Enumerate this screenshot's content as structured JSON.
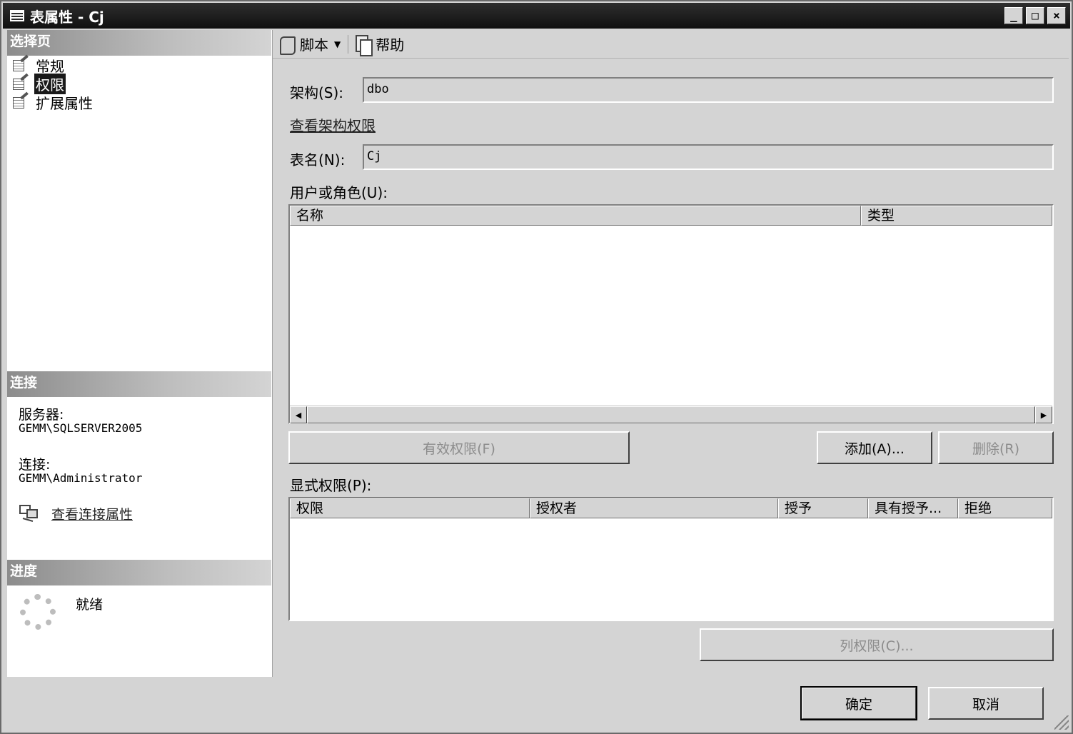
{
  "window": {
    "title": "表属性 - Cj",
    "controls": {
      "minimize": "_",
      "maximize": "□",
      "close": "×"
    }
  },
  "left": {
    "select_page_header": "选择页",
    "pages": [
      {
        "label": "常规",
        "selected": false
      },
      {
        "label": "权限",
        "selected": true
      },
      {
        "label": "扩展属性",
        "selected": false
      }
    ],
    "connection_header": "连接",
    "server_label": "服务器:",
    "server_value": "GEMM\\SQLSERVER2005",
    "connection_label": "连接:",
    "connection_value": "GEMM\\Administrator",
    "view_connection_link": "查看连接属性",
    "progress_header": "进度",
    "progress_status": "就绪"
  },
  "toolbar": {
    "script_label": "脚本",
    "help_label": "帮助"
  },
  "form": {
    "schema_label": "架构(S):",
    "schema_value": "dbo",
    "view_schema_permissions": "查看架构权限",
    "table_name_label": "表名(N):",
    "table_name_value": "Cj",
    "users_roles_label": "用户或角色(U):",
    "users_columns": [
      "名称",
      "类型"
    ],
    "effective_permissions_button": "有效权限(F)",
    "add_button": "添加(A)...",
    "remove_button": "删除(R)",
    "explicit_permissions_label": "显式权限(P):",
    "permission_columns": [
      "权限",
      "授权者",
      "授予",
      "具有授予...",
      "拒绝"
    ],
    "column_permissions_button": "列权限(C)..."
  },
  "footer": {
    "ok_button": "确定",
    "cancel_button": "取消"
  }
}
